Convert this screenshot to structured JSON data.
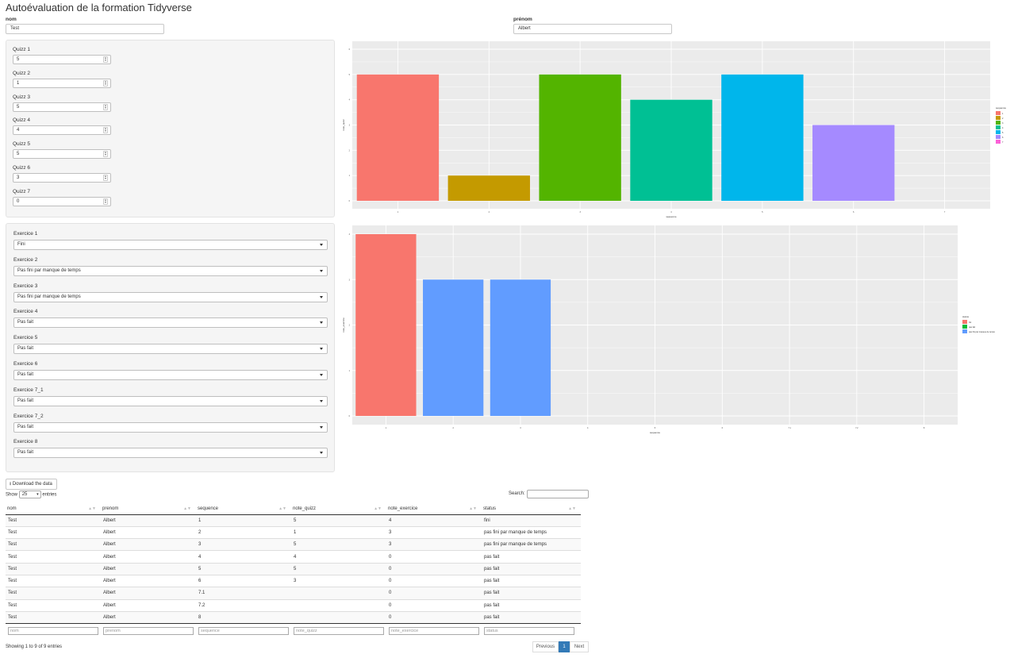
{
  "app_title": "Autoévaluation de la formation Tidyverse",
  "nom": {
    "label": "nom",
    "value": "Test"
  },
  "prenom": {
    "label": "prénom",
    "value": "Albert"
  },
  "quizz": [
    {
      "label": "Quizz 1",
      "value": "5"
    },
    {
      "label": "Quizz 2",
      "value": "1"
    },
    {
      "label": "Quizz 3",
      "value": "5"
    },
    {
      "label": "Quizz 4",
      "value": "4"
    },
    {
      "label": "Quizz 5",
      "value": "5"
    },
    {
      "label": "Quizz 6",
      "value": "3"
    },
    {
      "label": "Quizz 7",
      "value": "0"
    }
  ],
  "exercices": [
    {
      "label": "Exercice 1",
      "value": "Fini"
    },
    {
      "label": "Exercice 2",
      "value": "Pas fini par manque de temps"
    },
    {
      "label": "Exercice 3",
      "value": "Pas fini par manque de temps"
    },
    {
      "label": "Exercice 4",
      "value": "Pas fait"
    },
    {
      "label": "Exercice 5",
      "value": "Pas fait"
    },
    {
      "label": "Exercice 6",
      "value": "Pas fait"
    },
    {
      "label": "Exercice 7_1",
      "value": "Pas fait"
    },
    {
      "label": "Exercice 7_2",
      "value": "Pas fait"
    },
    {
      "label": "Exercice 8",
      "value": "Pas fait"
    }
  ],
  "download_label": "Download the data",
  "download_icon": "download-icon",
  "datatable": {
    "show_label": "Show",
    "length_value": "25",
    "entries_label": "entries",
    "search_label": "Search:",
    "columns": [
      "nom",
      "prenom",
      "sequence",
      "note_quizz",
      "note_exercice",
      "status"
    ],
    "rows": [
      [
        "Test",
        "Albert",
        "1",
        "5",
        "4",
        "fini"
      ],
      [
        "Test",
        "Albert",
        "2",
        "1",
        "3",
        "pas fini par manque de temps"
      ],
      [
        "Test",
        "Albert",
        "3",
        "5",
        "3",
        "pas fini par manque de temps"
      ],
      [
        "Test",
        "Albert",
        "4",
        "4",
        "0",
        "pas fait"
      ],
      [
        "Test",
        "Albert",
        "5",
        "5",
        "0",
        "pas fait"
      ],
      [
        "Test",
        "Albert",
        "6",
        "3",
        "0",
        "pas fait"
      ],
      [
        "Test",
        "Albert",
        "7.1",
        "",
        "0",
        "pas fait"
      ],
      [
        "Test",
        "Albert",
        "7.2",
        "",
        "0",
        "pas fait"
      ],
      [
        "Test",
        "Albert",
        "8",
        "",
        "0",
        "pas fait"
      ]
    ],
    "filter_placeholders": [
      "nom",
      "prenom",
      "sequence",
      "note_quizz",
      "note_exercice",
      "status"
    ],
    "info": "Showing 1 to 9 of 9 entries",
    "pagination": {
      "previous": "Previous",
      "current": "1",
      "next": "Next"
    }
  },
  "chart_data": [
    {
      "type": "bar",
      "xlabel": "sequence",
      "ylabel": "note_quizz",
      "categories": [
        "1",
        "2",
        "3",
        "4",
        "5",
        "6",
        "7"
      ],
      "values": [
        5,
        1,
        5,
        4,
        5,
        3,
        0
      ],
      "colors": [
        "#F8766D",
        "#C49A00",
        "#53B400",
        "#00C094",
        "#00B6EB",
        "#A58AFF",
        "#FB61D7"
      ],
      "ylim": [
        0,
        6
      ],
      "legend_title": "sequence",
      "legend_position": "right",
      "grid": true
    },
    {
      "type": "bar",
      "xlabel": "sequence",
      "ylabel": "note_exercice",
      "categories": [
        "1",
        "2",
        "3",
        "4",
        "5",
        "6",
        "7.1",
        "7.2",
        "8"
      ],
      "values": [
        4,
        3,
        3,
        0,
        0,
        0,
        0,
        0,
        0
      ],
      "bar_status": [
        "fini",
        "pas fini par manque de temps",
        "pas fini par manque de temps",
        "pas fait",
        "pas fait",
        "pas fait",
        "pas fait",
        "pas fait",
        "pas fait"
      ],
      "ylim": [
        0,
        4
      ],
      "legend_title": "status",
      "legend_entries": [
        {
          "name": "fini",
          "color": "#F8766D"
        },
        {
          "name": "pas fait",
          "color": "#00BA38"
        },
        {
          "name": "pas fini par manque de temps",
          "color": "#619CFF"
        }
      ],
      "legend_position": "right",
      "grid": true
    }
  ]
}
